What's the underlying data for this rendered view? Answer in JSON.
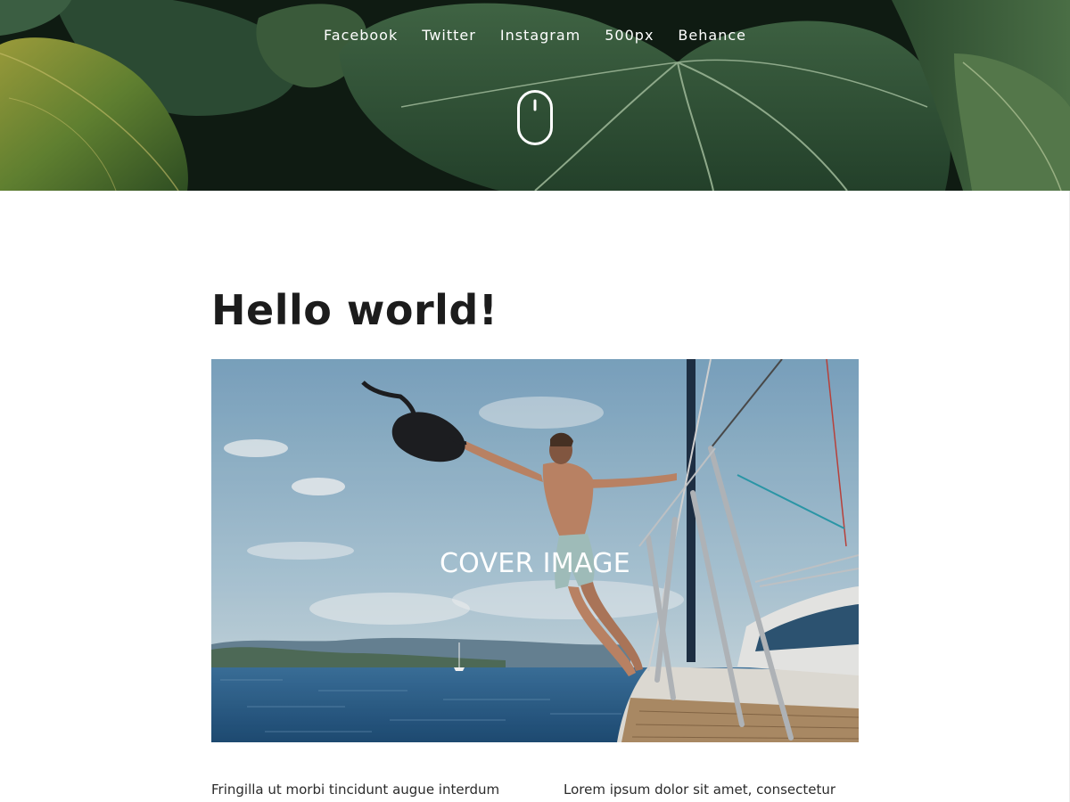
{
  "header": {
    "social_links": [
      {
        "label": "Facebook"
      },
      {
        "label": "Twitter"
      },
      {
        "label": "Instagram"
      },
      {
        "label": "500px"
      },
      {
        "label": "Behance"
      }
    ],
    "scroll_icon": "mouse-icon"
  },
  "post": {
    "title": "Hello world!",
    "cover_label": "COVER IMAGE",
    "excerpt_left": "Fringilla ut morbi tincidunt augue interdum",
    "excerpt_right": "Lorem ipsum dolor sit amet, consectetur"
  },
  "colors": {
    "leaf_dark": "#1f3a22",
    "leaf_mid": "#3d6b3a",
    "leaf_light": "#6f8f3c",
    "title_text": "#1c1c1c",
    "body_text": "#2b2b2b",
    "sky": "#8fb6cf",
    "sea": "#2c5f86"
  }
}
